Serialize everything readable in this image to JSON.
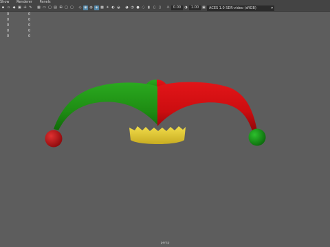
{
  "menubar": {
    "items": [
      "Show",
      "Renderer",
      "Panels"
    ]
  },
  "toolbar": {
    "exposure": "0.00",
    "gamma": "1.00",
    "colorspace": "ACES 1.0 SDR-video (sRGB)"
  },
  "hud": {
    "rows": [
      {
        "a": "0",
        "b": "0"
      },
      {
        "a": "0",
        "b": "0"
      },
      {
        "a": "0",
        "b": "0"
      },
      {
        "a": "0",
        "b": "0"
      },
      {
        "a": "0",
        "b": "0"
      }
    ]
  },
  "viewport": {
    "background": "#5d5d5d",
    "camera_label": "persp",
    "model": {
      "left_horn_color": "#1e8c13",
      "right_horn_color": "#cc0d10",
      "left_ball_color": "#c20f14",
      "right_ball_color": "#169c16",
      "band_color": "#e8d036"
    }
  }
}
